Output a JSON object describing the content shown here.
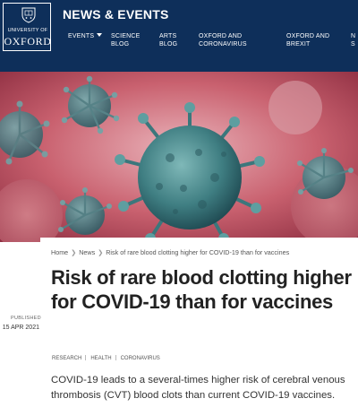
{
  "logo": {
    "line1": "UNIVERSITY OF",
    "line2": "OXFORD"
  },
  "site": {
    "title": "NEWS & EVENTS"
  },
  "nav": {
    "items": [
      {
        "line1": "EVENTS",
        "line2": "",
        "has_caret": true
      },
      {
        "line1": "SCIENCE",
        "line2": "BLOG"
      },
      {
        "line1": "ARTS",
        "line2": "BLOG"
      },
      {
        "line1": "OXFORD AND",
        "line2": "CORONAVIRUS"
      },
      {
        "line1": "OXFORD AND",
        "line2": "BREXIT"
      },
      {
        "line1": "N",
        "line2": "S"
      }
    ]
  },
  "breadcrumb": {
    "home": "Home",
    "news": "News",
    "current": "Risk of rare blood clotting higher for COVID-19 than for vaccines",
    "separator": "❯"
  },
  "article": {
    "headline": "Risk of rare blood clotting higher for COVID-19 than for vaccines",
    "published_label": "PUBLISHED",
    "published_date": "15 APR 2021",
    "tags": [
      "RESEARCH",
      "HEALTH",
      "CORONAVIRUS"
    ],
    "summary": "COVID-19 leads to a several-times higher risk of cerebral venous thrombosis (CVT) blood clots than current COVID-19 vaccines."
  },
  "colors": {
    "header_bg": "#0e2f5a",
    "hero_bg": "#c7606f",
    "virus_teal": "#4f8f93"
  },
  "hero_image": {
    "subject": "coronavirus-illustration"
  }
}
